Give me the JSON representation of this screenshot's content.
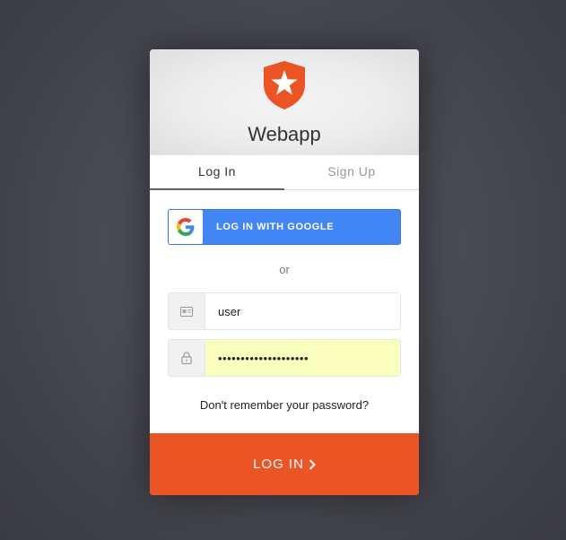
{
  "app": {
    "title": "Webapp"
  },
  "tabs": [
    {
      "label": "Log In",
      "active": true
    },
    {
      "label": "Sign Up",
      "active": false
    }
  ],
  "social": {
    "google_label": "LOG IN WITH GOOGLE"
  },
  "divider": {
    "text": "or"
  },
  "username": {
    "value": "user",
    "icon": "id-card-icon"
  },
  "password": {
    "value": "••••••••••••••••••••",
    "icon": "lock-icon"
  },
  "forgot": {
    "label": "Don't remember your password?"
  },
  "submit": {
    "label": "LOG IN",
    "icon": "chevron-right-icon"
  },
  "colors": {
    "accent": "#eb5424",
    "google": "#4285f4",
    "autofill": "#faffbd"
  }
}
